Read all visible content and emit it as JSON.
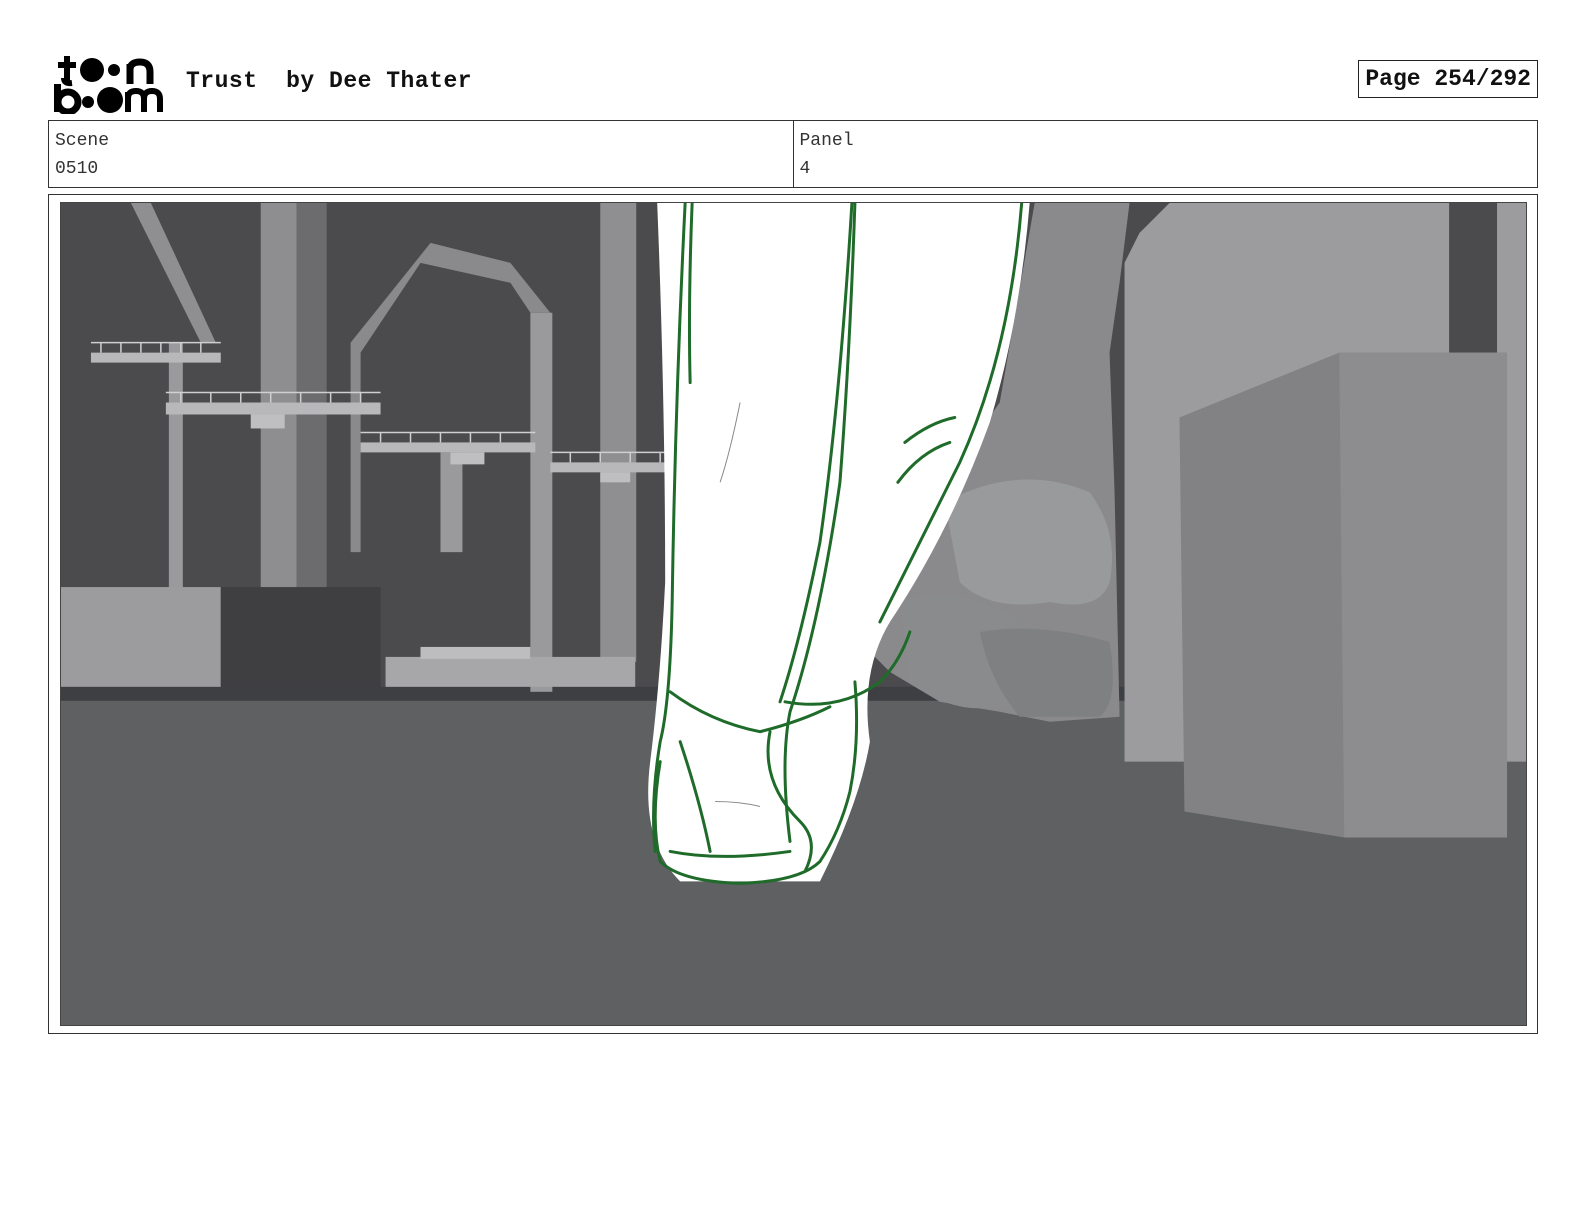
{
  "header": {
    "logo_text": "toon boom",
    "title": "Trust  by Dee Thater",
    "page_label": "Page 254/292"
  },
  "info": {
    "scene_label": "Scene",
    "scene_value": "0510",
    "panel_label": "Panel",
    "panel_value": "4"
  },
  "panel": {
    "description_icon": "storyboard-panel-image",
    "sketch_color": "#1f6b2a"
  }
}
